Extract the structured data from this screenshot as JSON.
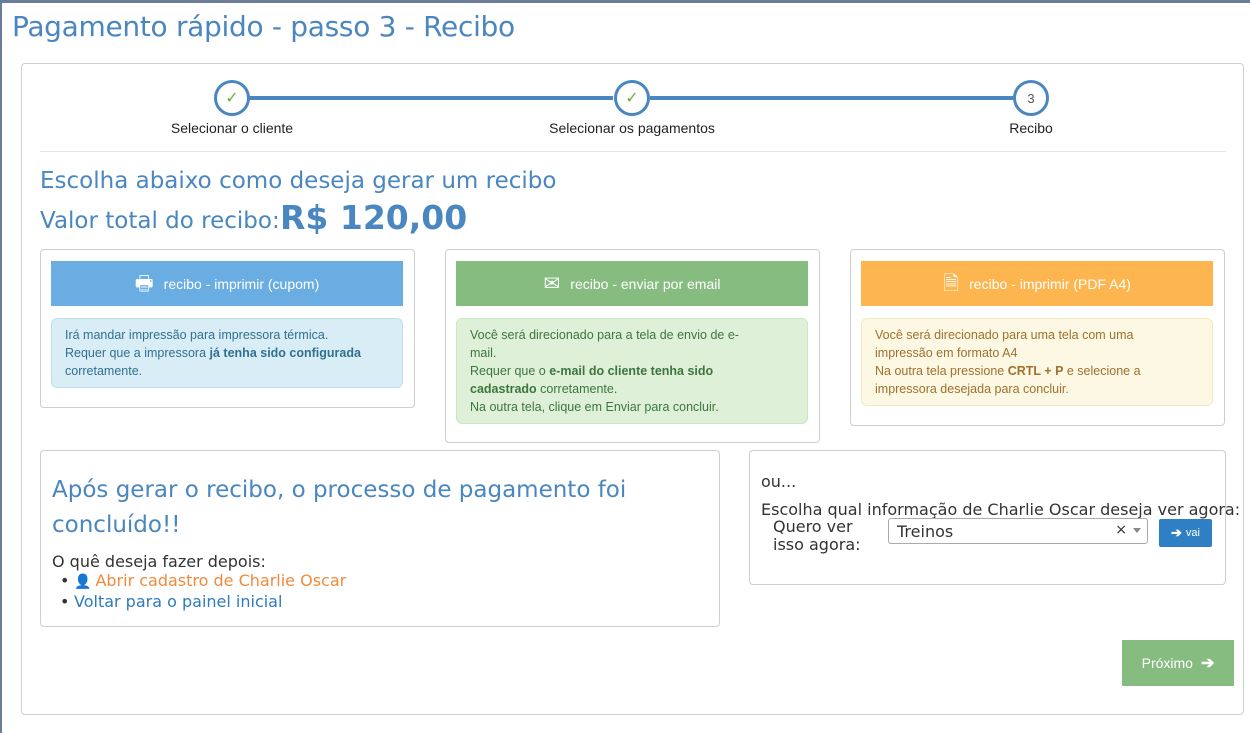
{
  "page": {
    "title": "Pagamento rápido - passo 3 - Recibo"
  },
  "steps": [
    {
      "label": "Selecionar o cliente",
      "state": "done",
      "icon": "check-icon"
    },
    {
      "label": "Selecionar os pagamentos",
      "state": "done",
      "icon": "check-icon"
    },
    {
      "label": "Recibo",
      "state": "current",
      "number": "3"
    }
  ],
  "receipt": {
    "heading": "Escolha abaixo como deseja gerar um recibo",
    "total_label": "Valor total do recibo:",
    "total_value": "R$ 120,00"
  },
  "options": {
    "print_coupon": {
      "label": "recibo - imprimir (cupom)",
      "icon": "printer-icon",
      "line1": "Irá mandar impressão para impressora térmica.",
      "line2a": "Requer que a impressora ",
      "line2b": "já tenha sido configurada",
      "line3": "corretamente."
    },
    "send_email": {
      "label": "recibo - enviar por email",
      "icon": "envelope-icon",
      "line1": "Você será direcionado para a tela de envio de e-",
      "line1b": "mail.",
      "line2a": "Requer que o ",
      "line2b": "e-mail do cliente tenha sido",
      "line2c": "cadastrado",
      "line2d": " corretamente.",
      "line3": "Na outra tela, clique em Enviar para concluir."
    },
    "print_pdf": {
      "label": "recibo - imprimir (PDF A4)",
      "icon": "file-icon",
      "line1": "Você será direcionado para uma tela com uma",
      "line1b": "impressão em formato A4",
      "line2a": "Na outra tela pressione ",
      "line2b": "CRTL + P",
      "line2c": " e selecione a",
      "line3": "impressora desejada para concluir."
    }
  },
  "completion": {
    "title": "Após gerar o recibo, o processo de pagamento foi concluído!!",
    "question": "O quê deseja fazer depois:",
    "link_client": "Abrir cadastro de Charlie Oscar",
    "link_panel": "Voltar para o painel inicial"
  },
  "quick_view": {
    "or": "ou...",
    "instruction": "Escolha qual informação de Charlie Oscar deseja ver agora:",
    "label": "Quero ver isso agora:",
    "selected": "Treinos",
    "clear": "×",
    "go": "vai"
  },
  "next_label": "Próximo",
  "colors": {
    "accent": "#4a86c0",
    "print_btn": "#6aade2",
    "email_btn": "#87bc81",
    "pdf_btn": "#fdb54f",
    "go_btn": "#2e7fc4"
  }
}
